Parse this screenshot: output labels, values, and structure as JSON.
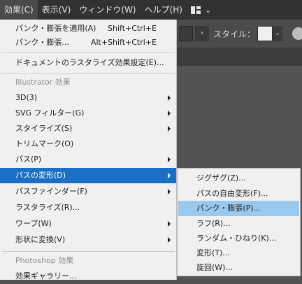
{
  "menubar": {
    "items": [
      {
        "label": "効果(C)",
        "active": true
      },
      {
        "label": "表示(V)"
      },
      {
        "label": "ウィンドウ(W)"
      },
      {
        "label": "ヘルプ(H)"
      }
    ],
    "workspace_switcher_icon": "workspace-grid-icon",
    "workspace_chevron": "⌄"
  },
  "controlbar": {
    "arrow_glyph": "›",
    "style_label": "スタイル：",
    "swatch_color": "#efefef",
    "dropdown_glyph": "⌄"
  },
  "effect_menu": {
    "apply_last": {
      "label": "パンク・膨張を適用(A)",
      "shortcut": "Shift+Ctrl+E"
    },
    "last_effect": {
      "label": "パンク・膨張...",
      "shortcut": "Alt+Shift+Ctrl+E"
    },
    "document_raster": {
      "label": "ドキュメントのラスタライズ効果設定(E)..."
    },
    "illustrator_header": "Illustrator 効果",
    "illustrator_items": [
      {
        "label": "3D(3)",
        "submenu": true
      },
      {
        "label": "SVG フィルター(G)",
        "submenu": true
      },
      {
        "label": "スタイライズ(S)",
        "submenu": true
      },
      {
        "label": "トリムマーク(O)",
        "submenu": false
      },
      {
        "label": "パス(P)",
        "submenu": true
      },
      {
        "label": "パスの変形(D)",
        "submenu": true,
        "highlighted": true
      },
      {
        "label": "パスファインダー(F)",
        "submenu": true
      },
      {
        "label": "ラスタライズ(R)...",
        "submenu": false
      },
      {
        "label": "ワープ(W)",
        "submenu": true
      },
      {
        "label": "形状に変換(V)",
        "submenu": true
      }
    ],
    "photoshop_header": "Photoshop 効果",
    "photoshop_items": [
      {
        "label": "効果ギャラリー..."
      }
    ]
  },
  "distort_submenu": {
    "items": [
      {
        "label": "ジグザグ(Z)..."
      },
      {
        "label": "パスの自由変形(F)..."
      },
      {
        "label": "パンク・膨張(P)...",
        "highlighted": true
      },
      {
        "label": "ラフ(R)..."
      },
      {
        "label": "ランダム・ひねり(K)..."
      },
      {
        "label": "変形(T)..."
      },
      {
        "label": "旋回(W)..."
      }
    ]
  },
  "colors": {
    "menu_highlight": "#1c6fc6",
    "submenu_highlight": "#99c9ef",
    "menubar_bg": "#323232"
  }
}
